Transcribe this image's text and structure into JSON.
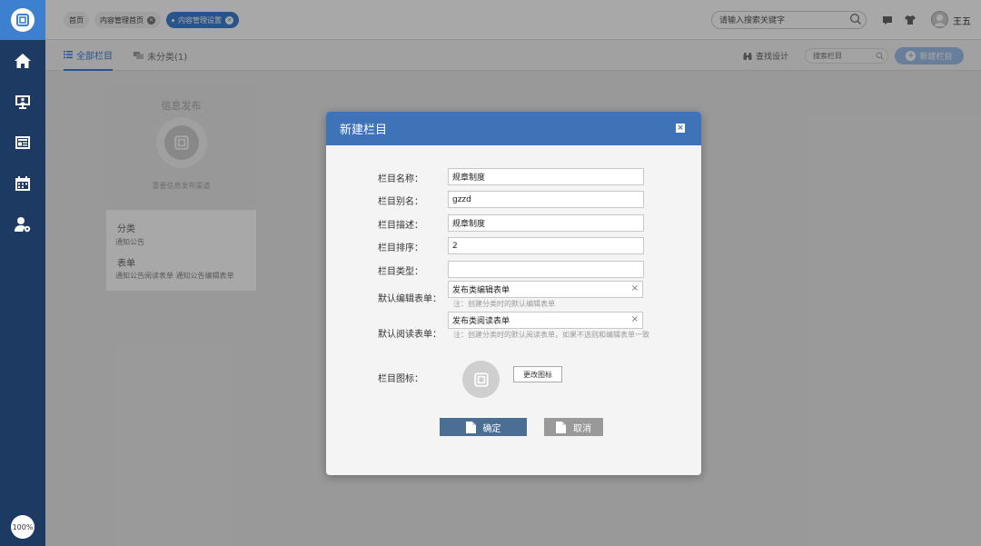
{
  "tabs_breadcrumb": [
    {
      "label": "首页"
    },
    {
      "label": "内容管理首页"
    },
    {
      "label": "内容管理设置"
    }
  ],
  "search": {
    "placeholder": "请输入搜索关键字"
  },
  "user": {
    "name": "王五"
  },
  "sidebar": {
    "items": [
      {
        "icon": "home-icon"
      },
      {
        "icon": "monitor-user-icon"
      },
      {
        "icon": "news-icon"
      },
      {
        "icon": "calendar-icon"
      },
      {
        "icon": "user-settings-icon"
      }
    ],
    "zoom": "100%"
  },
  "toolbar": {
    "tab_all": "全部栏目",
    "tab_unclassified": "未分类(1)",
    "find_design": "查找设计",
    "column_search_placeholder": "搜索栏目",
    "new_column": "新建栏目"
  },
  "card": {
    "title": "信息发布",
    "description": "重要信息发布渠道",
    "category_label": "分类",
    "category_value": "通知公告",
    "form_label": "表单",
    "form_value": "通知公告阅读表单   通知公告编辑表单"
  },
  "modal": {
    "title": "新建栏目",
    "close": "×",
    "fields": {
      "name_label": "栏目名称：",
      "name_value": "规章制度",
      "alias_label": "栏目别名：",
      "alias_value": "gzzd",
      "desc_label": "栏目描述：",
      "desc_value": "规章制度",
      "order_label": "栏目排序：",
      "order_value": "2",
      "type_label": "栏目类型：",
      "type_value": "",
      "edit_form_label": "默认编辑表单：",
      "edit_form_value": "发布类编辑表单",
      "edit_form_note": "注：创建分类时的默认编辑表单",
      "read_form_label": "默认阅读表单：",
      "read_form_value": "发布类阅读表单",
      "read_form_note": "注：创建分类时的默认阅读表单，如果不选则和编辑表单一致",
      "icon_label": "栏目图标：",
      "change_icon": "更改图标"
    },
    "ok": "确定",
    "cancel": "取消"
  },
  "colors": {
    "sidebar": "#1d3a63",
    "accent": "#3e80d0",
    "modal_header": "#3e73b7",
    "ok_button": "#4a6e94",
    "cancel_button": "#999999"
  }
}
